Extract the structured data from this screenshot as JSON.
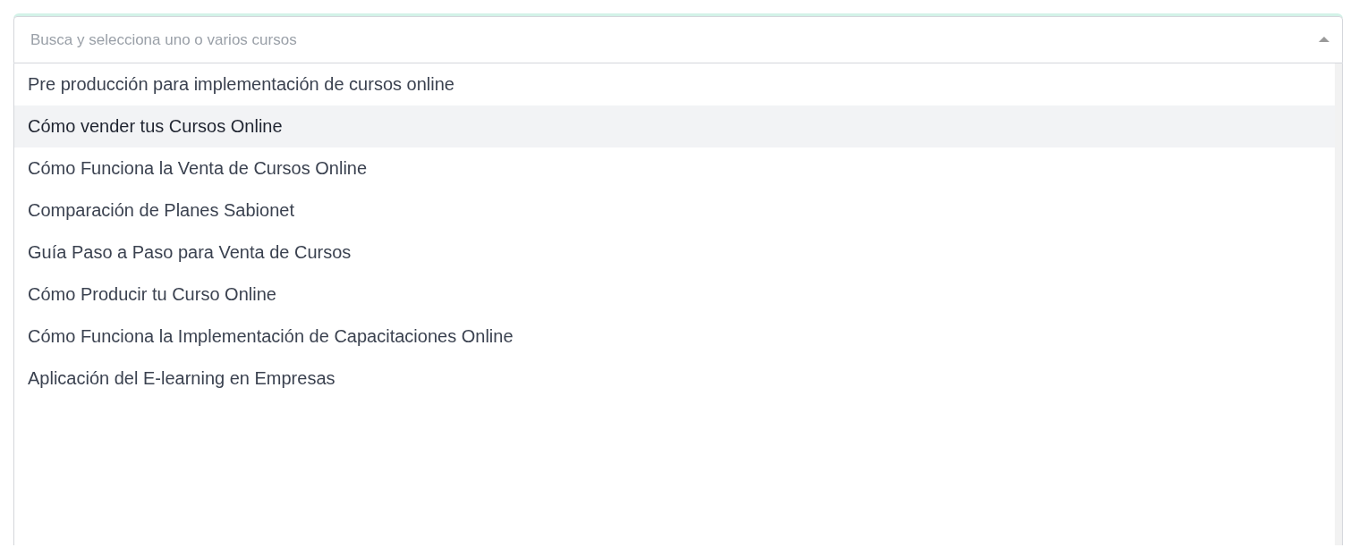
{
  "select": {
    "placeholder": "Busca y selecciona uno o varios cursos",
    "expanded": true,
    "options": [
      {
        "label": "Pre producción para implementación de cursos online",
        "highlighted": false
      },
      {
        "label": "Cómo vender tus Cursos Online",
        "highlighted": true
      },
      {
        "label": "Cómo Funciona la Venta de Cursos Online",
        "highlighted": false
      },
      {
        "label": "Comparación de Planes Sabionet",
        "highlighted": false
      },
      {
        "label": "Guía Paso a Paso para Venta de Cursos",
        "highlighted": false
      },
      {
        "label": "Cómo Producir tu Curso Online",
        "highlighted": false
      },
      {
        "label": "Cómo Funciona la Implementación de Capacitaciones Online",
        "highlighted": false
      },
      {
        "label": "Aplicación del E-learning en Empresas",
        "highlighted": false
      }
    ]
  }
}
